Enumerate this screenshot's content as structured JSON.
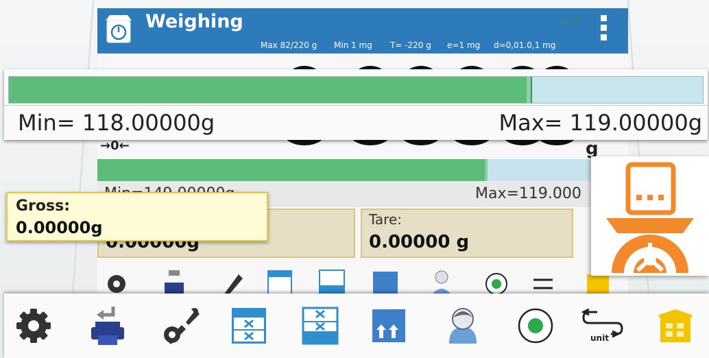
{
  "header": {
    "title": "Weighing",
    "specs": [
      "Max 82/220 g",
      "Min 1 mg",
      "T= -220 g",
      "e=1 mg",
      "d=0,01.0,1 mg"
    ],
    "status_indicators": "⁂ ⁂"
  },
  "background_screen": {
    "min_label": "Min=149.00000g",
    "max_label": "Max=119.000",
    "tare_label": "Tare:",
    "tare_value": "0.00000 g",
    "net_value": "0.00000g",
    "bargraph_fill": 0.73
  },
  "bargraph": {
    "fill_fraction": 0.746,
    "mark_fraction": 0.752,
    "min_text": "Min= 118.00000g",
    "max_text": "Max= 119.00000g"
  },
  "gross": {
    "label": "Gross:",
    "value": "0.00000g"
  },
  "toolbar": {
    "items": [
      {
        "icon": "settings-gear-icon"
      },
      {
        "icon": "print-icon"
      },
      {
        "icon": "tools-icon"
      },
      {
        "icon": "tare-memory-icon"
      },
      {
        "icon": "database-icon"
      },
      {
        "icon": "stack-icon"
      },
      {
        "icon": "user-icon"
      },
      {
        "icon": "record-icon"
      },
      {
        "icon": "unit-change-icon"
      },
      {
        "icon": "warehouse-icon"
      }
    ],
    "unit_glyph": "unit"
  },
  "colors": {
    "header_blue": "#2e7bbc",
    "bar_green": "#5cbd78",
    "bar_bg": "#c8e5ee",
    "accent_orange": "#f2892a",
    "gross_bg": "#fffbd6"
  }
}
